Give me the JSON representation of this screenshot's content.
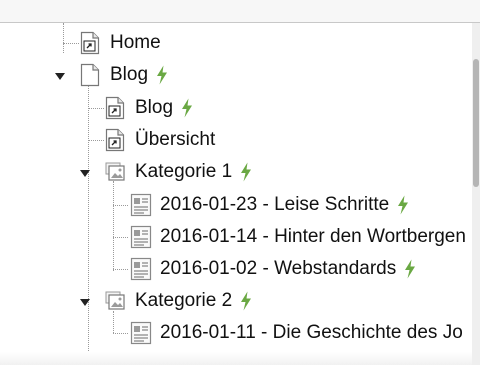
{
  "tree": {
    "items": [
      {
        "label": "Home",
        "icon": "page-shortcut-icon",
        "collapse": "",
        "flash": false
      },
      {
        "label": "Blog",
        "icon": "page-icon",
        "collapse": "expanded",
        "flash": true
      },
      {
        "label": "Blog",
        "icon": "page-shortcut-icon",
        "collapse": "",
        "flash": true
      },
      {
        "label": "Übersicht",
        "icon": "page-shortcut-icon",
        "collapse": "",
        "flash": false
      },
      {
        "label": "Kategorie 1",
        "icon": "folder-image-icon",
        "collapse": "expanded",
        "flash": true
      },
      {
        "label": "2016-01-23 - Leise Schritte",
        "icon": "article-icon",
        "collapse": "",
        "flash": true
      },
      {
        "label": "2016-01-14 - Hinter den Wortbergen",
        "icon": "article-icon",
        "collapse": "",
        "flash": false
      },
      {
        "label": "2016-01-02 - Webstandards",
        "icon": "article-icon",
        "collapse": "",
        "flash": true
      },
      {
        "label": "Kategorie 2",
        "icon": "folder-image-icon",
        "collapse": "expanded",
        "flash": true
      },
      {
        "label": "2016-01-11 - Die Geschichte des Jo",
        "icon": "article-icon",
        "collapse": "",
        "flash": false
      }
    ]
  },
  "colors": {
    "flash": "#6aa843",
    "tree_line": "#9a9a9a"
  }
}
